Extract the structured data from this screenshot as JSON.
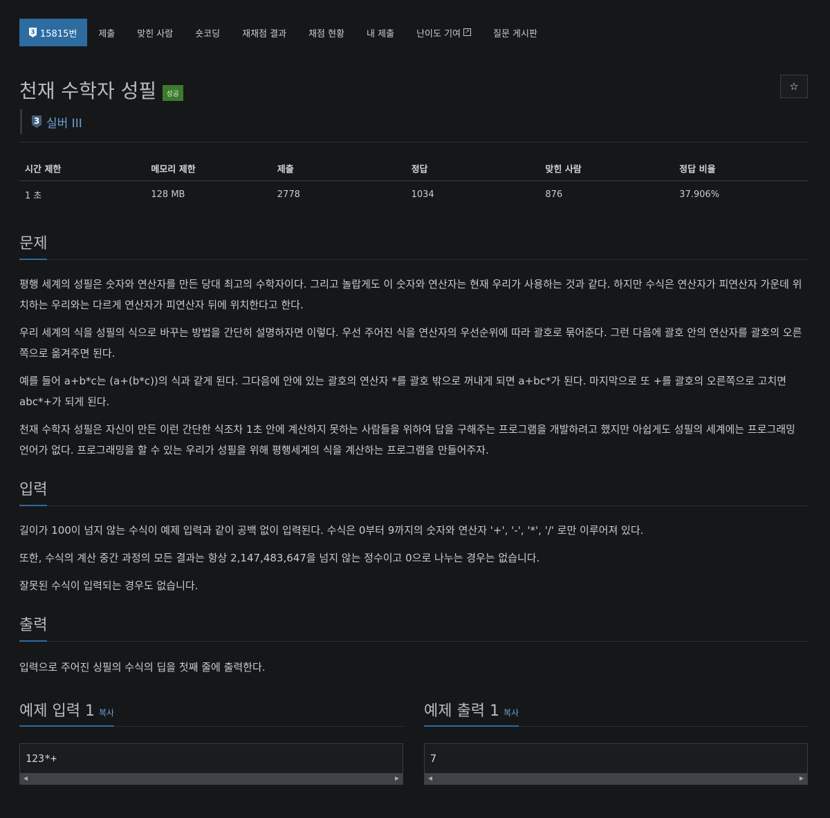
{
  "nav": {
    "items": [
      {
        "tier": "3",
        "label": "15815번"
      },
      {
        "label": "제출"
      },
      {
        "label": "맞힌 사람"
      },
      {
        "label": "숏코딩"
      },
      {
        "label": "재채점 결과"
      },
      {
        "label": "채점 현황"
      },
      {
        "label": "내 제출"
      },
      {
        "label": "난이도 기여"
      },
      {
        "label": "질문 게시판"
      }
    ]
  },
  "problem": {
    "title": "천재 수학자 성필",
    "status_badge": "성공",
    "star": "☆",
    "tier_num": "3",
    "tier_name": "실버 III"
  },
  "stats": {
    "headers": [
      "시간 제한",
      "메모리 제한",
      "제출",
      "정답",
      "맞힌 사람",
      "정답 비율"
    ],
    "values": [
      "1 초",
      "128 MB",
      "2778",
      "1034",
      "876",
      "37.906%"
    ]
  },
  "sections": {
    "problem_heading": "문제",
    "problem_paragraphs": [
      "평행 세계의 성필은 숫자와 연산자를 만든 당대 최고의 수학자이다. 그리고 놀랍게도 이 숫자와 연산자는 현재 우리가 사용하는 것과 같다. 하지만 수식은 연산자가 피연산자 가운데 위치하는 우리와는 다르게 연산자가 피연산자 뒤에 위치한다고 한다.",
      "우리 세계의 식을 성필의 식으로 바꾸는 방법을 간단히 설명하자면 이렇다. 우선 주어진 식을 연산자의 우선순위에 따라 괄호로 묶어준다. 그런 다음에 괄호 안의 연산자를 괄호의 오른쪽으로 옮겨주면 된다.",
      "예를 들어 a+b*c는 (a+(b*c))의 식과 같게 된다. 그다음에 안에 있는 괄호의 연산자 *를 괄호 밖으로 꺼내게 되면 a+bc*가 된다. 마지막으로 또 +를 괄호의 오른쪽으로 고치면 abc*+가 되게 된다.",
      "천재 수학자 성필은 자신이 만든 이런 간단한 식조차 1초 안에 계산하지 못하는 사람들을 위하여 답을 구해주는 프로그램을 개발하려고 했지만 아쉽게도 성필의 세계에는 프로그래밍 언어가 없다. 프로그래밍을 할 수 있는 우리가 성필을 위해 평행세계의 식을 계산하는 프로그램을 만들어주자."
    ],
    "input_heading": "입력",
    "input_paragraphs": [
      "길이가 100이 넘지 않는 수식이 예제 입력과 같이 공백 없이 입력된다. 수식은 0부터 9까지의 숫자와 연산자 '+', '-', '*', '/' 로만 이루어져 있다.",
      "또한, 수식의 계산 중간 과정의 모든 결과는 항상 2,147,483,647을 넘지 않는 정수이고 0으로 나누는 경우는 없습니다.",
      "잘못된 수식이 입력되는 경우도 없습니다."
    ],
    "output_heading": "출력",
    "output_paragraphs": [
      "입력으로 주어진 싱필의 수식의 딥을 첫째 줄에 출력한다."
    ]
  },
  "samples": {
    "input_title": "예제 입력 1",
    "output_title": "예제 출력 1",
    "copy_label": "복사",
    "input_value": "123*+",
    "output_value": "7"
  }
}
